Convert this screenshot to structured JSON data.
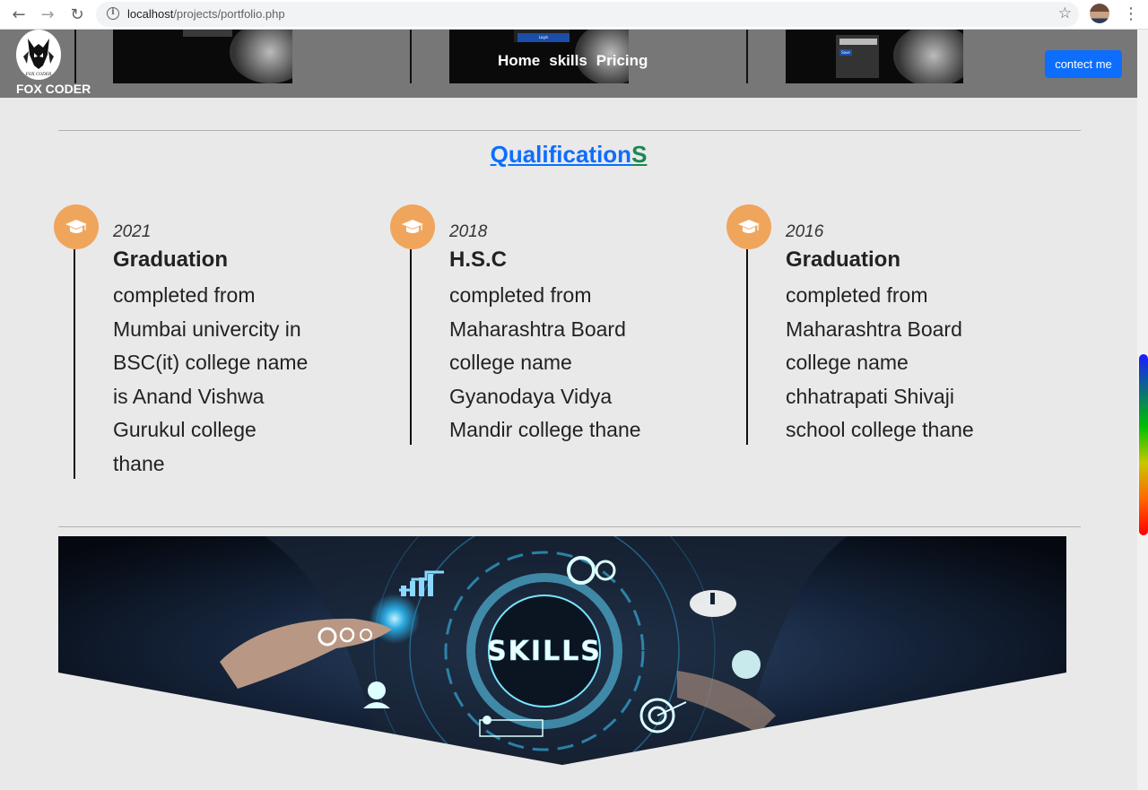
{
  "browser": {
    "url_host": "localhost",
    "url_path": "/projects/portfolio.php"
  },
  "header": {
    "brand": "FOX CODER",
    "logo_text": "FOX CODER",
    "nav": [
      "Home",
      "skills",
      "Pricing"
    ],
    "contact_label": "contect me",
    "thumb_buttons": [
      "Login",
      "Save"
    ]
  },
  "qualifications": {
    "title_main": "Qualification",
    "title_end": "S",
    "items": [
      {
        "year": "2021",
        "degree": "Graduation",
        "lines": [
          "completed from",
          "Mumbai univercity in",
          "BSC(it) college name",
          "is Anand Vishwa",
          "Gurukul college",
          "thane"
        ]
      },
      {
        "year": "2018",
        "degree": "H.S.C",
        "lines": [
          "completed from",
          "Maharashtra Board",
          "college name",
          "Gyanodaya Vidya",
          "Mandir college thane"
        ]
      },
      {
        "year": "2016",
        "degree": "Graduation",
        "lines": [
          "completed from",
          "Maharashtra Board",
          "college name",
          "chhatrapati Shivaji",
          "school college thane"
        ]
      }
    ]
  },
  "skills_banner": {
    "text": "SKILLS"
  },
  "colors": {
    "accent_blue": "#0d6efd",
    "accent_green": "#198754",
    "icon_orange": "#f0a55c",
    "header_gray": "#777777"
  }
}
